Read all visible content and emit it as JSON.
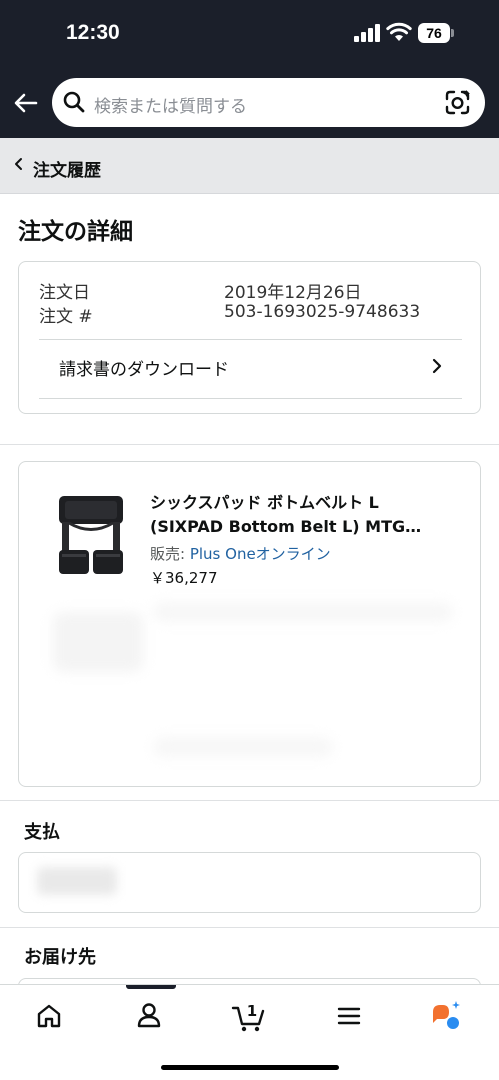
{
  "status_bar": {
    "time": "12:30",
    "battery": "76"
  },
  "header": {
    "search_placeholder": "検索または質問する"
  },
  "breadcrumb": {
    "label": "注文履歴"
  },
  "order": {
    "title": "注文の詳細",
    "date_label": "注文日",
    "date_value": "2019年12月26日",
    "number_label": "注文 #",
    "number_value": "503-1693025-9748633",
    "invoice_label": "請求書のダウンロード"
  },
  "product": {
    "title_line1": "シックスパッド ボトムベルト L",
    "title_line2": "(SIXPAD Bottom Belt L) MTG…",
    "seller_prefix": "販売: ",
    "seller_name": "Plus Oneオンライン",
    "price": "￥36,277"
  },
  "sections": {
    "payment_title": "支払",
    "shipping_title": "お届け先"
  },
  "bottom_nav": {
    "items": [
      "home-icon",
      "account-icon",
      "cart-icon",
      "menu-icon",
      "rufus-icon"
    ],
    "cart_count": "1"
  },
  "colors": {
    "header_bg": "#1b1f2a",
    "link": "#2162a1",
    "rufus_orange": "#f2712f",
    "rufus_blue": "#2a8cf0"
  }
}
